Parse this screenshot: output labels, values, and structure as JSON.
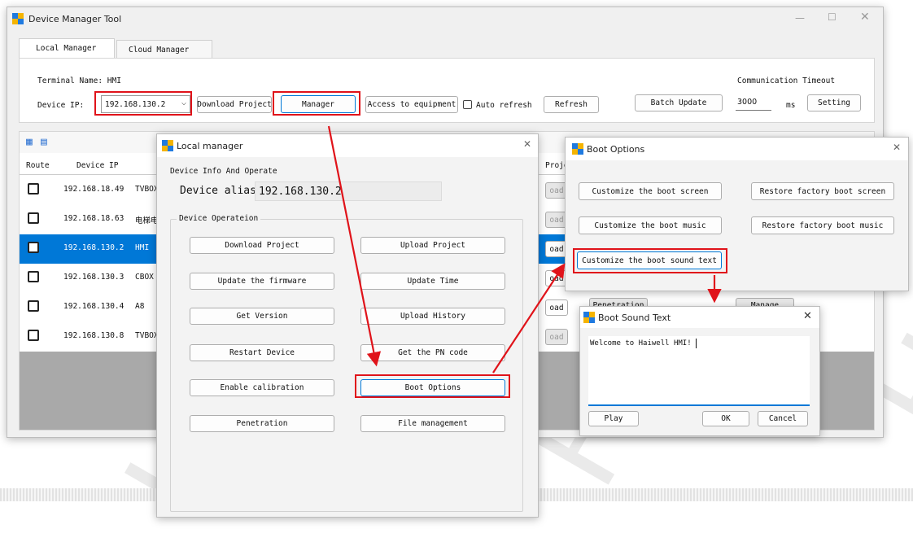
{
  "main_window": {
    "title": "Device Manager Tool",
    "tabs": [
      {
        "label": "Local Manager"
      },
      {
        "label": "Cloud Manager"
      }
    ],
    "terminal_name": "Terminal Name: HMI",
    "device_ip_label": "Device IP:",
    "device_ip_value": "192.168.130.2",
    "buttons": {
      "download_project": "Download Project",
      "manager": "Manager",
      "access": "Access to equipment",
      "auto_refresh": "Auto refresh",
      "refresh": "Refresh",
      "batch_update": "Batch Update",
      "setting": "Setting"
    },
    "comm_timeout_label": "Communication Timeout",
    "comm_timeout_value": "3000",
    "comm_timeout_unit": "ms",
    "table": {
      "columns": [
        "Route",
        "Device IP",
        "Projec"
      ],
      "rows": [
        {
          "ip": "192.168.18.49",
          "name": "TVBOX",
          "action": "oad"
        },
        {
          "ip": "192.168.18.63",
          "name": "电梯电",
          "action": "oad"
        },
        {
          "ip": "192.168.130.2",
          "name": "HMI",
          "action": "oad"
        },
        {
          "ip": "192.168.130.3",
          "name": "CBOX",
          "action": "oad"
        },
        {
          "ip": "192.168.130.4",
          "name": "A8",
          "action": "oad"
        },
        {
          "ip": "192.168.130.8",
          "name": "TVBOX",
          "action": "oad"
        }
      ]
    },
    "behind_buttons": {
      "penetration": "Penetration",
      "manage": "Manage"
    }
  },
  "local_manager": {
    "title": "Local manager",
    "group_info": "Device Info And Operate",
    "alias_label": "Device alias",
    "alias_value": "192.168.130.2",
    "group_ops": "Device Operateion",
    "buttons": [
      "Download Project",
      "Upload Project",
      "Update the firmware",
      "Update Time",
      "Get Version",
      "Upload History",
      "Restart Device",
      "Get the PN code",
      "Enable calibration",
      "Boot Options",
      "Penetration",
      "File management"
    ]
  },
  "boot_options": {
    "title": "Boot Options",
    "buttons": [
      "Customize the boot screen",
      "Restore factory boot screen",
      "Customize the boot music",
      "Restore factory boot music",
      "Customize the boot sound text"
    ]
  },
  "boot_sound_text": {
    "title": "Boot Sound Text",
    "text_value": "Welcome to Haiwell HMI! ",
    "play": "Play",
    "ok": "OK",
    "cancel": "Cancel"
  },
  "watermark": "Haiwell",
  "colors": {
    "highlight": "#e0131a",
    "selection": "#0078d7"
  }
}
